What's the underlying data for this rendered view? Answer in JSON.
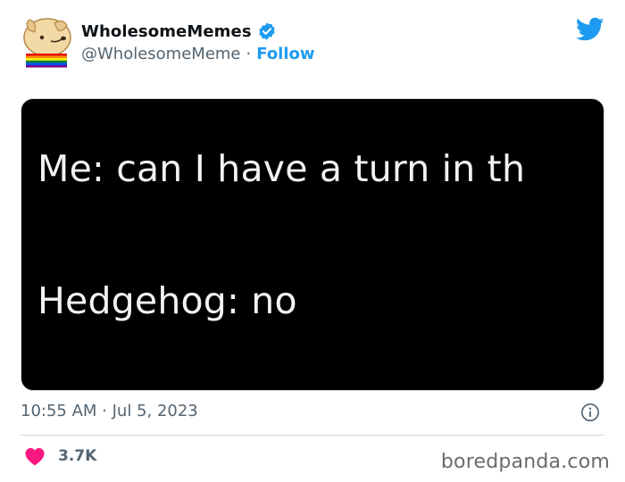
{
  "author": {
    "display_name": "WholesomeMemes",
    "handle": "@WholesomeMeme",
    "separator": "·",
    "follow_label": "Follow"
  },
  "icons": {
    "avatar": "dog-avatar-icon",
    "verified": "verified-badge-icon",
    "brand": "twitter-bird-icon",
    "info": "info-icon",
    "like": "heart-icon"
  },
  "media": {
    "line1": "Me: can I have a turn in th",
    "line2": "Hedgehog: no"
  },
  "meta": {
    "timestamp": "10:55 AM · Jul 5, 2023"
  },
  "engagement": {
    "likes": "3.7K"
  },
  "watermark": "boredpanda.com",
  "colors": {
    "accent": "#1d9bf0",
    "like": "#f91880",
    "muted_text": "#536471"
  }
}
